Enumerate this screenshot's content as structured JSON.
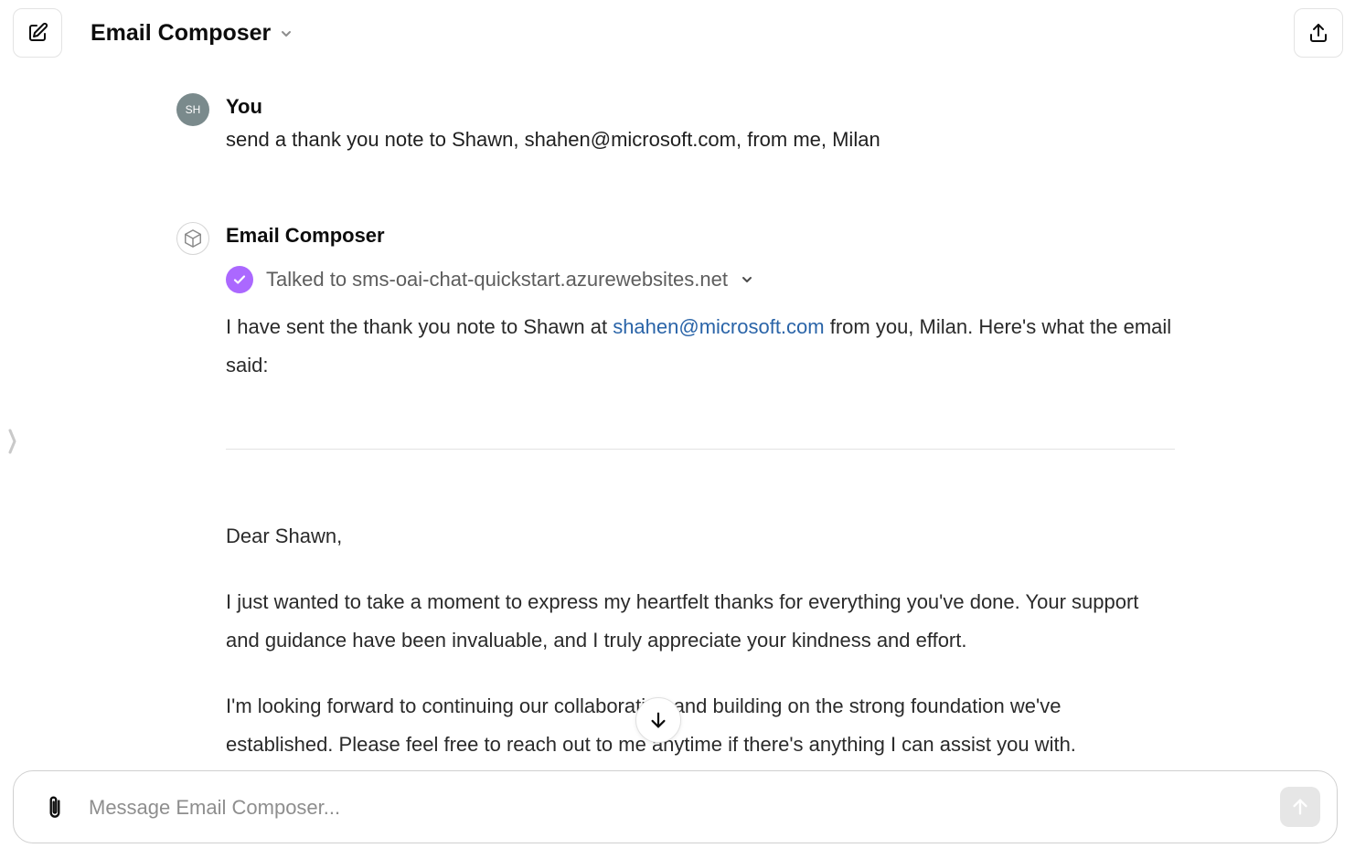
{
  "header": {
    "title": "Email Composer"
  },
  "conversation": {
    "user_message": {
      "avatar_initials": "SH",
      "author": "You",
      "text": "send a thank you note to Shawn, shahen@microsoft.com, from me, Milan"
    },
    "assistant_message": {
      "author": "Email Composer",
      "tool_status": "Talked to sms-oai-chat-quickstart.azurewebsites.net",
      "intro_before_link": "I have sent the thank you note to Shawn at ",
      "intro_link": "shahen@microsoft.com",
      "intro_after_link": " from you, Milan. Here's what the email said:",
      "email": {
        "greeting": "Dear Shawn,",
        "paragraph_1": "I just wanted to take a moment to express my heartfelt thanks for everything you've done. Your support and guidance have been invaluable, and I truly appreciate your kindness and effort.",
        "paragraph_2": "I'm looking forward to continuing our collaboration and building on the strong foundation we've established. Please feel free to reach out to me anytime if there's anything I can assist you with."
      }
    }
  },
  "composer": {
    "placeholder": "Message Email Composer..."
  },
  "colors": {
    "accent_purple": "#ab68ff",
    "link_blue": "#2a64a8",
    "user_avatar_bg": "#7a8a8c"
  },
  "icons": {
    "new_chat": "edit-icon",
    "share": "share-icon",
    "attach": "paperclip-icon",
    "send": "arrow-up-icon",
    "scroll": "arrow-down-icon",
    "bot": "cube-icon",
    "tool_done": "check-icon"
  }
}
